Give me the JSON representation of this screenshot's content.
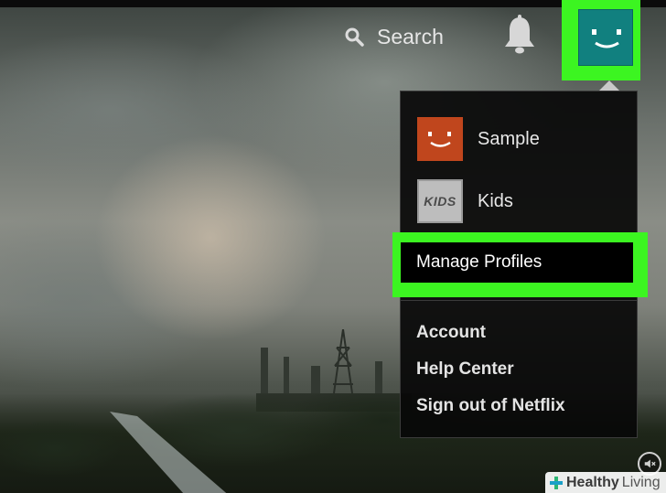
{
  "header": {
    "search_label": "Search",
    "search_icon": "search-icon",
    "notifications_icon": "bell-icon",
    "profile_icon": "smiley-avatar-icon"
  },
  "dropdown": {
    "profiles": [
      {
        "name": "Sample",
        "avatar_color": "#c0461d",
        "avatar_icon": "smiley-avatar-icon"
      },
      {
        "name": "Kids",
        "avatar_color": "#bdbdbd",
        "avatar_text": "KIDS"
      }
    ],
    "manage_profiles_label": "Manage Profiles",
    "links": [
      "Account",
      "Help Center",
      "Sign out of Netflix"
    ]
  },
  "highlight_color": "#3cf521",
  "accent_avatar_color": "#11807f",
  "watermark": {
    "brand": "Healthy",
    "brand_suffix": "Living"
  }
}
